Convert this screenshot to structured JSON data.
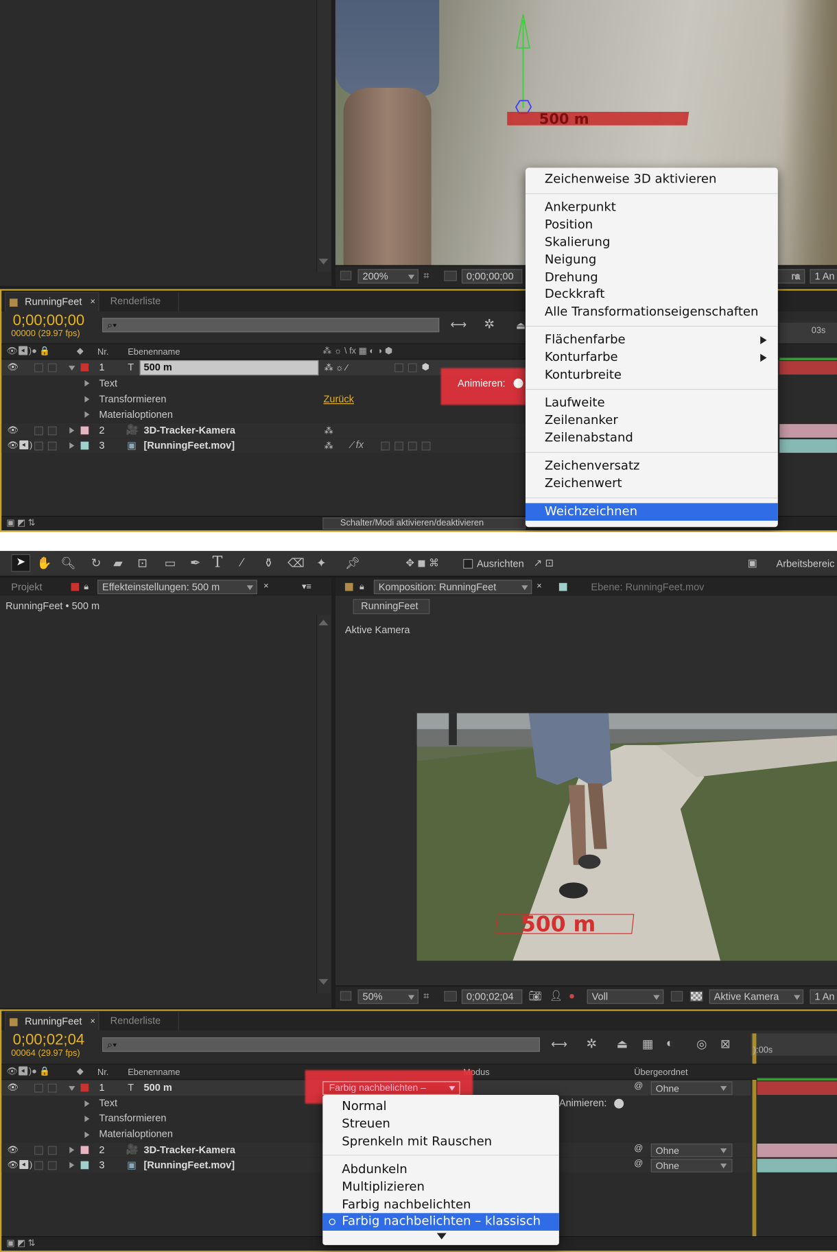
{
  "top": {
    "viewer": {
      "zoom": "200%",
      "timecode": "0;00;00;00",
      "camera_partial": "ra",
      "views_partial": "1 An"
    },
    "timeline": {
      "tabs": [
        "RunningFeet",
        "Renderliste"
      ],
      "time": "0;00;00;00",
      "frames": "00000 (29.97 fps)",
      "ruler_label": "03s",
      "columns": {
        "nr": "Nr.",
        "name": "Ebenenname"
      },
      "layers": [
        {
          "nr": "1",
          "name": "500 m",
          "color": "#c8322f"
        },
        {
          "nr": "2",
          "name": "3D-Tracker-Kamera",
          "color": "#e8b4c0"
        },
        {
          "nr": "3",
          "name": "[RunningFeet.mov]",
          "color": "#9fd0cc"
        }
      ],
      "sub_items": [
        "Text",
        "Transformieren",
        "Materialoptionen"
      ],
      "reset_link": "Zurück",
      "animate_label": "Animieren:",
      "footer_toggle": "Schalter/Modi aktivieren/deaktivieren"
    },
    "context_menu": {
      "groups": [
        [
          "Zeichenweise 3D aktivieren"
        ],
        [
          "Ankerpunkt",
          "Position",
          "Skalierung",
          "Neigung",
          "Drehung",
          "Deckkraft",
          "Alle Transformationseigenschaften"
        ],
        [
          "Flächenfarbe",
          "Konturfarbe",
          "Konturbreite"
        ],
        [
          "Laufweite",
          "Zeilenanker",
          "Zeilenabstand"
        ],
        [
          "Zeichenversatz",
          "Zeichenwert"
        ],
        [
          "Weichzeichnen"
        ]
      ],
      "highlighted": "Weichzeichnen",
      "submenu_items": [
        "Flächenfarbe",
        "Konturfarbe"
      ]
    },
    "scene_text": "500 m"
  },
  "bottom": {
    "toolbar": {
      "snap_label": "Ausrichten",
      "workspace_label": "Arbeitsbereic"
    },
    "left_panel": {
      "tab_project": "Projekt",
      "tab_effects": "Effekteinstellungen: 500 m",
      "breadcrumb": "RunningFeet • 500 m"
    },
    "comp_panel": {
      "tab_comp": "Komposition: RunningFeet",
      "tab_layer": "Ebene: RunningFeet.mov",
      "comp_button": "RunningFeet",
      "active_camera_label": "Aktive Kamera",
      "scene_text": "500 m"
    },
    "viewer": {
      "zoom": "50%",
      "timecode": "0;00;02;04",
      "resolution": "Voll",
      "camera": "Aktive Kamera",
      "views_partial": "1 An"
    },
    "timeline": {
      "tabs": [
        "RunningFeet",
        "Renderliste"
      ],
      "time": "0;00;02;04",
      "frames": "00064 (29.97 fps)",
      "ruler_label": "):00s",
      "columns": {
        "nr": "Nr.",
        "name": "Ebenenname",
        "mode": "Modus",
        "parent": "Übergeordnet"
      },
      "layers": [
        {
          "nr": "1",
          "name": "500 m",
          "color": "#c8322f",
          "parent": "Ohne"
        },
        {
          "nr": "2",
          "name": "3D-Tracker-Kamera",
          "color": "#e8b4c0",
          "parent": "Ohne"
        },
        {
          "nr": "3",
          "name": "[RunningFeet.mov]",
          "color": "#9fd0cc",
          "parent": "Ohne"
        }
      ],
      "sub_items": [
        "Text",
        "Transformieren",
        "Materialoptionen"
      ],
      "mode_value": "Farbig nachbelichten –",
      "animate_label": "Animieren:"
    },
    "mode_menu": {
      "groups": [
        [
          "Normal",
          "Streuen",
          "Sprenkeln mit Rauschen"
        ],
        [
          "Abdunkeln",
          "Multiplizieren",
          "Farbig nachbelichten",
          "Farbig nachbelichten – klassisch"
        ]
      ],
      "selected": "Farbig nachbelichten – klassisch"
    }
  },
  "colors": {
    "accent_yellow": "#e8b320",
    "menu_highlight": "#2f6ce5",
    "callout_red": "#e8323c",
    "panel_bg": "#2b2b2b"
  }
}
